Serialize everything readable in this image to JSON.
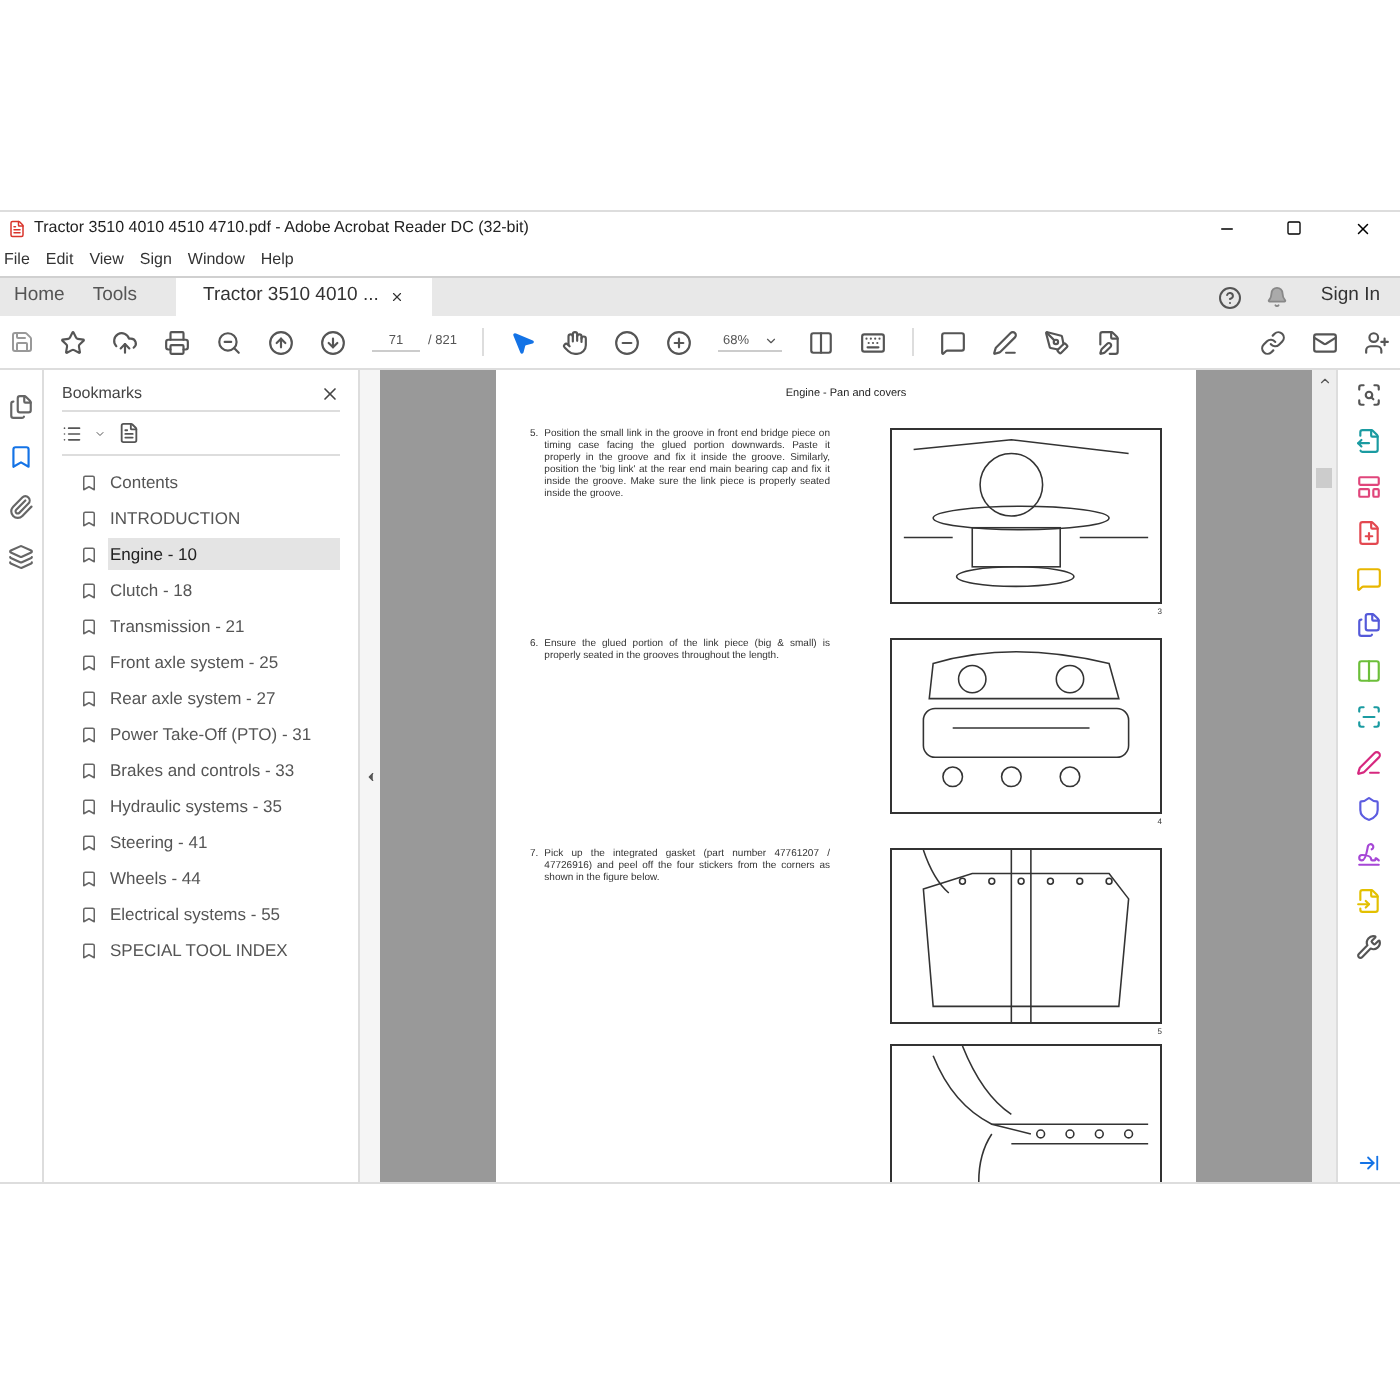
{
  "window": {
    "title": "Tractor 3510 4010 4510 4710.pdf - Adobe Acrobat Reader DC (32-bit)"
  },
  "menu": [
    "File",
    "Edit",
    "View",
    "Sign",
    "Window",
    "Help"
  ],
  "tabs": [
    {
      "label": "Home",
      "selected": false,
      "kind": "nav"
    },
    {
      "label": "Tools",
      "selected": false,
      "kind": "nav"
    },
    {
      "label": "Tractor 3510 4010 ...",
      "selected": true,
      "kind": "document"
    }
  ],
  "sign_in": "Sign In",
  "toolbar": {
    "page": "71",
    "page_count": "/ 821",
    "zoom": "68%"
  },
  "left_rail": [
    {
      "kind": "pages",
      "selected": false
    },
    {
      "kind": "bookmarks",
      "selected": true
    },
    {
      "kind": "attachments",
      "selected": false
    },
    {
      "kind": "layers",
      "selected": false
    }
  ],
  "bookmarks": {
    "title": "Bookmarks",
    "items": [
      {
        "label": "Contents",
        "selected": false
      },
      {
        "label": "INTRODUCTION",
        "selected": false
      },
      {
        "label": "Engine - 10",
        "selected": true
      },
      {
        "label": "Clutch - 18",
        "selected": false
      },
      {
        "label": "Transmission - 21",
        "selected": false
      },
      {
        "label": "Front axle system - 25",
        "selected": false
      },
      {
        "label": "Rear axle system - 27",
        "selected": false
      },
      {
        "label": "Power Take-Off (PTO) - 31",
        "selected": false
      },
      {
        "label": "Brakes and controls - 33",
        "selected": false
      },
      {
        "label": "Hydraulic systems - 35",
        "selected": false
      },
      {
        "label": "Steering - 41",
        "selected": false
      },
      {
        "label": "Wheels - 44",
        "selected": false
      },
      {
        "label": "Electrical systems - 55",
        "selected": false
      },
      {
        "label": "SPECIAL TOOL INDEX",
        "selected": false
      }
    ]
  },
  "page": {
    "header": "Engine - Pan and covers",
    "steps": [
      {
        "number": "5.",
        "text": "Position the small link in the groove in front end bridge piece on timing case facing the glued portion downwards. Paste it properly in the groove and fix it inside the groove. Similarly, position the 'big link' at the rear end main bearing cap and fix it inside the groove. Make sure the link piece is properly seated inside the groove.",
        "figures": [
          {
            "kind": "pulley",
            "number": "3"
          }
        ]
      },
      {
        "number": "6.",
        "text": "Ensure the glued portion of the link piece (big & small) is properly seated in the grooves throughout the length.",
        "figures": [
          {
            "kind": "block",
            "number": "4"
          }
        ]
      },
      {
        "number": "7.",
        "text": "Pick up the integrated gasket (part number 47761207 / 47726916) and peel off the four stickers from the corners as shown in the figure below.",
        "figures": [
          {
            "kind": "gasket",
            "number": "5"
          },
          {
            "kind": "peel"
          }
        ]
      }
    ]
  },
  "tools_rail": [
    {
      "kind": "zoom",
      "color": "#555555"
    },
    {
      "kind": "export",
      "color": "#1a9ba1"
    },
    {
      "kind": "edit",
      "color": "#e0457b"
    },
    {
      "kind": "create",
      "color": "#e34850"
    },
    {
      "kind": "comment",
      "color": "#e8b600"
    },
    {
      "kind": "combine",
      "color": "#5459d9"
    },
    {
      "kind": "organize",
      "color": "#6cbf3a"
    },
    {
      "kind": "scan",
      "color": "#1a9ba1"
    },
    {
      "kind": "fill",
      "color": "#d6287f"
    },
    {
      "kind": "protect",
      "color": "#5c5ce0"
    },
    {
      "kind": "sign",
      "color": "#a647d6"
    },
    {
      "kind": "send",
      "color": "#e3c000"
    },
    {
      "kind": "more",
      "color": "#555555"
    }
  ]
}
